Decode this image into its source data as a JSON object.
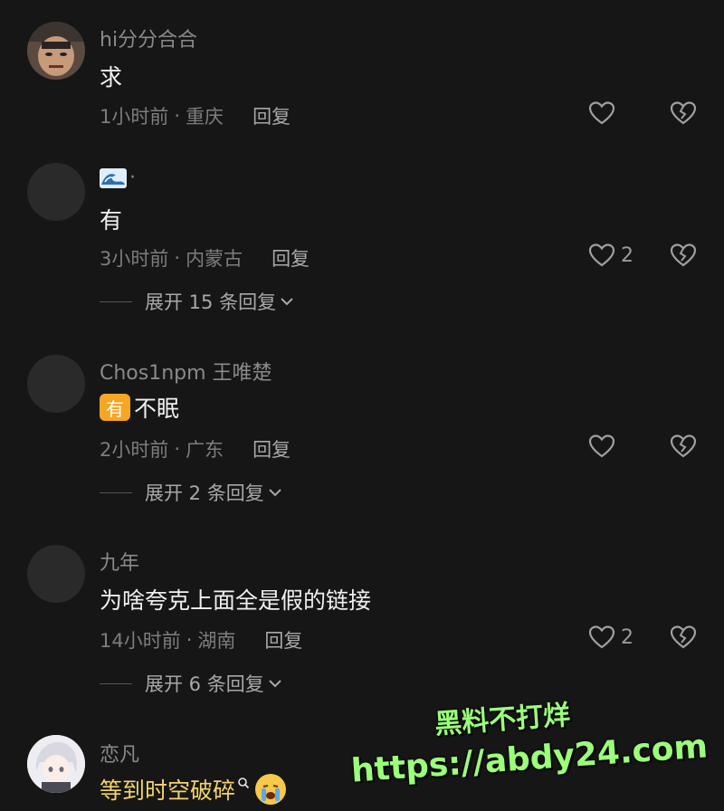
{
  "comments": [
    {
      "username": "hi分分合合",
      "content": "求",
      "time": "1小时前",
      "sep": "·",
      "location": "重庆",
      "reply_label": "回复",
      "likes": "",
      "avatar": "avatar-photo"
    },
    {
      "username": "·",
      "username_icon": "wave-emoji",
      "content": "有",
      "time": "3小时前",
      "sep": "·",
      "location": "内蒙古",
      "reply_label": "回复",
      "likes": "2",
      "expand": "展开 15 条回复"
    },
    {
      "username": "Chos1npm 王唯楚",
      "content_badge": "有",
      "content": "不眠",
      "time": "2小时前",
      "sep": "·",
      "location": "广东",
      "reply_label": "回复",
      "likes": "",
      "expand": "展开 2 条回复"
    },
    {
      "username": "九年",
      "content": "为啥夸克上面全是假的链接",
      "time": "14小时前",
      "sep": "·",
      "location": "湖南",
      "reply_label": "回复",
      "likes": "2",
      "expand": "展开 6 条回复"
    },
    {
      "username": "恋凡",
      "content": "等到时空破碎",
      "content_icons": [
        "search-icon",
        "crying-emoji"
      ],
      "avatar": "anime-avatar"
    }
  ],
  "watermark": {
    "line1": "黑料不打烊",
    "line2": "https://abdy24.com"
  },
  "colors": {
    "background": "#161616",
    "badge": "#f5a623",
    "watermark": "#9bff7a"
  }
}
